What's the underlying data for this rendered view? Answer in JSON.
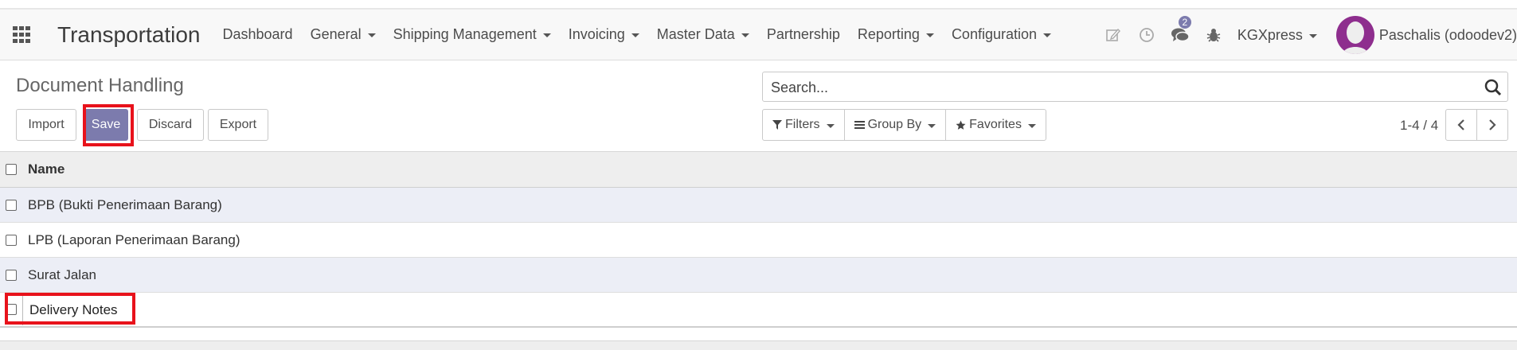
{
  "navbar": {
    "brand": "Transportation",
    "menu": [
      {
        "label": "Dashboard"
      },
      {
        "label": "General"
      },
      {
        "label": "Shipping Management"
      },
      {
        "label": "Invoicing"
      },
      {
        "label": "Master Data"
      },
      {
        "label": "Partnership"
      },
      {
        "label": "Reporting"
      },
      {
        "label": "Configuration"
      }
    ],
    "icons": [
      "edit-icon",
      "clock-icon",
      "chat-icon",
      "bug-icon"
    ],
    "message_badge": "2",
    "company": "KGXpress",
    "user": "Paschalis (odoodev2)"
  },
  "control_panel": {
    "title": "Document Handling",
    "buttons": {
      "import": "Import",
      "save": "Save",
      "discard": "Discard",
      "export": "Export"
    },
    "search_placeholder": "Search...",
    "filters": "Filters",
    "group_by": "Group By",
    "favorites": "Favorites",
    "pager": "1-4 / 4"
  },
  "table": {
    "columns": [
      "Name"
    ],
    "rows": [
      {
        "name": "BPB (Bukti Penerimaan Barang)"
      },
      {
        "name": "LPB (Laporan Penerimaan Barang)"
      },
      {
        "name": "Surat Jalan"
      }
    ],
    "editing_row": {
      "name": "Delivery Notes"
    }
  },
  "colors": {
    "primary": "#7c7bad",
    "highlight": "#e8121b",
    "row_alt": "#eceef6"
  }
}
